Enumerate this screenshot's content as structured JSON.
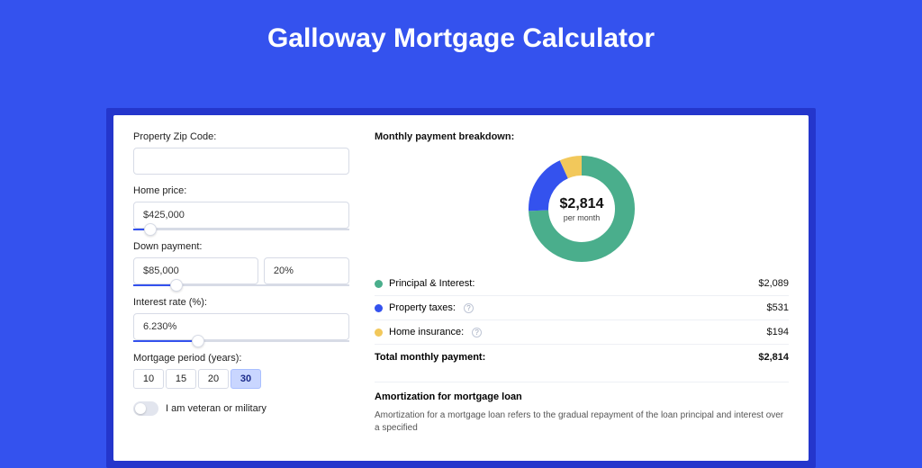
{
  "page_title": "Galloway Mortgage Calculator",
  "inputs": {
    "zip_label": "Property Zip Code:",
    "zip_value": "",
    "home_price_label": "Home price:",
    "home_price_value": "$425,000",
    "home_price_slider_pct": 8,
    "down_payment_label": "Down payment:",
    "down_payment_value": "$85,000",
    "down_payment_pct_value": "20%",
    "down_payment_slider_pct": 20,
    "interest_label": "Interest rate (%):",
    "interest_value": "6.230%",
    "interest_slider_pct": 30,
    "period_label": "Mortgage period (years):",
    "period_options": [
      "10",
      "15",
      "20",
      "30"
    ],
    "period_selected": "30",
    "veteran_label": "I am veteran or military",
    "veteran_checked": false
  },
  "breakdown": {
    "title": "Monthly payment breakdown:",
    "center_amount": "$2,814",
    "center_sub": "per month",
    "items": [
      {
        "label": "Principal & Interest:",
        "value": "$2,089",
        "color": "green",
        "help": false
      },
      {
        "label": "Property taxes:",
        "value": "$531",
        "color": "blue",
        "help": true
      },
      {
        "label": "Home insurance:",
        "value": "$194",
        "color": "yellow",
        "help": true
      }
    ],
    "total_label": "Total monthly payment:",
    "total_value": "$2,814"
  },
  "amortization": {
    "title": "Amortization for mortgage loan",
    "text": "Amortization for a mortgage loan refers to the gradual repayment of the loan principal and interest over a specified"
  },
  "chart_data": {
    "type": "pie",
    "title": "Monthly payment breakdown",
    "series": [
      {
        "name": "Principal & Interest",
        "value": 2089,
        "color": "#4aae8c"
      },
      {
        "name": "Property taxes",
        "value": 531,
        "color": "#3452ee"
      },
      {
        "name": "Home insurance",
        "value": 194,
        "color": "#f2c85b"
      }
    ],
    "total": 2814,
    "center_label": "$2,814 per month"
  }
}
